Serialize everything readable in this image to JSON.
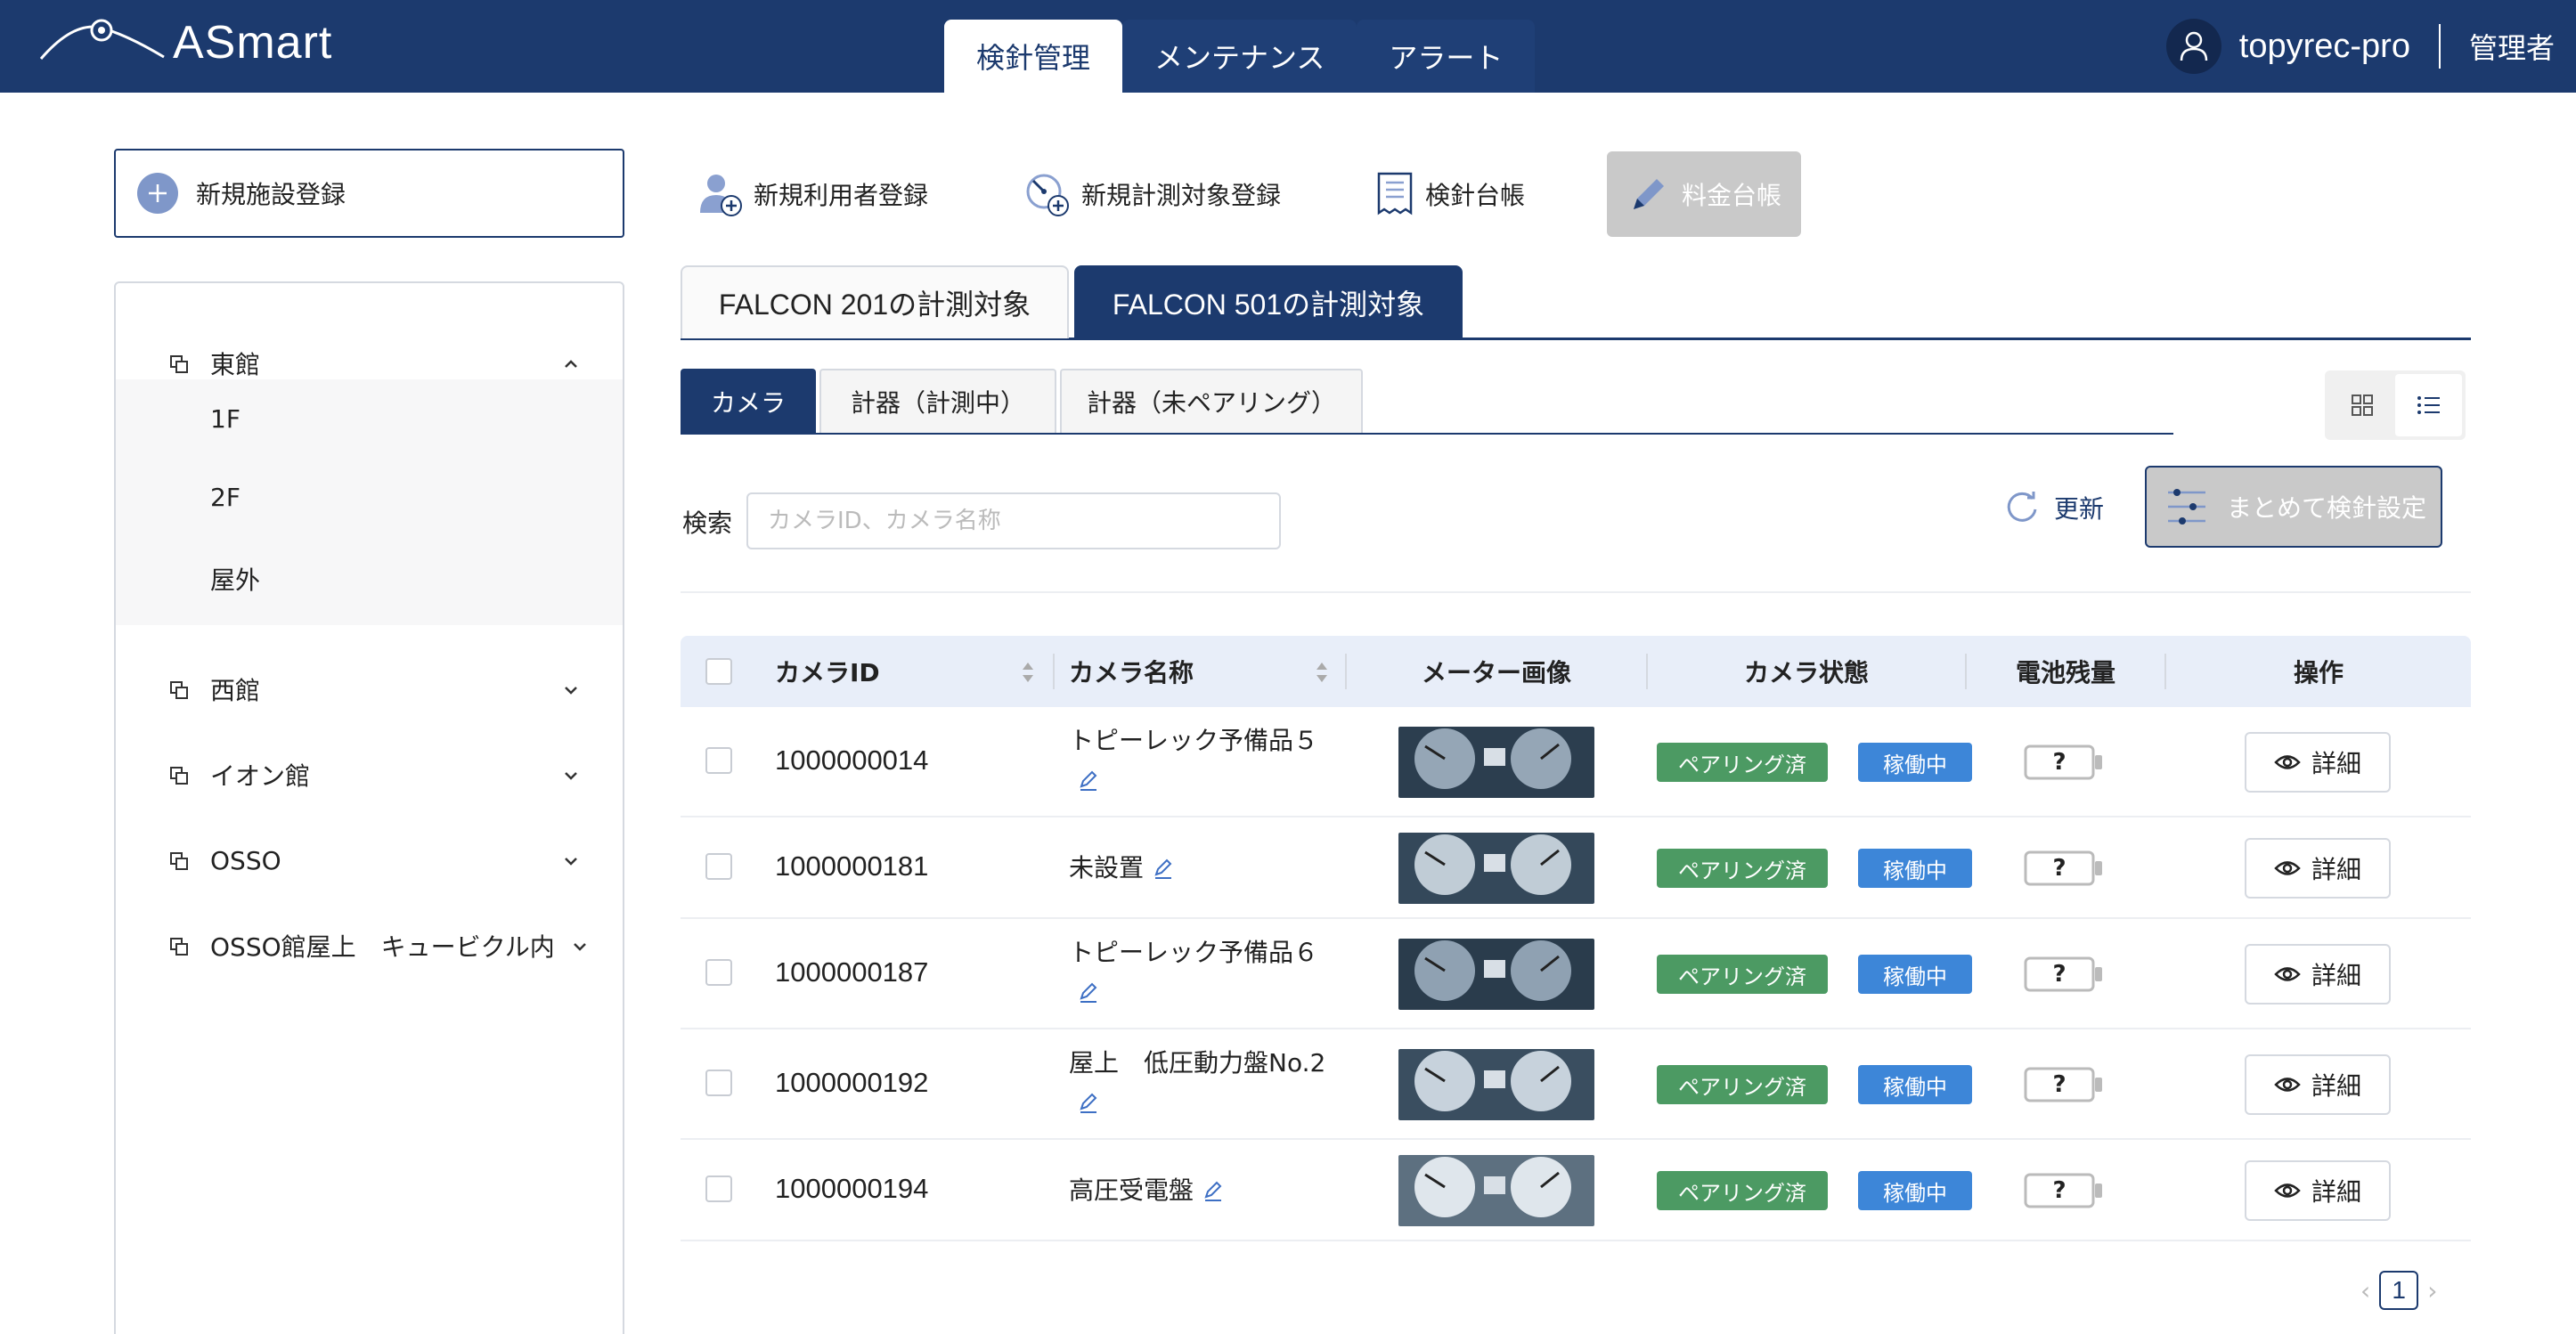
{
  "app": {
    "logo_text": "ASmart"
  },
  "nav": {
    "tabs": [
      "検針管理",
      "メンテナンス",
      "アラート"
    ],
    "active": 0
  },
  "user": {
    "name": "topyrec-pro",
    "role": "管理者"
  },
  "sidebar": {
    "new_facility_label": "新規施設登録",
    "tree": [
      {
        "label": "東館",
        "expanded": true,
        "children": [
          "1F",
          "2F",
          "屋外"
        ]
      },
      {
        "label": "西館",
        "expanded": false
      },
      {
        "label": "イオン館",
        "expanded": false
      },
      {
        "label": "OSSO",
        "expanded": false
      },
      {
        "label": "OSSO館屋上　キュービクル内",
        "expanded": false
      }
    ]
  },
  "toolbar": {
    "new_user": "新規利用者登録",
    "new_target": "新規計測対象登録",
    "ledger": "検針台帳",
    "fee_ledger": "料金台帳"
  },
  "main_tabs": [
    "FALCON 201の計測対象",
    "FALCON 501の計測対象"
  ],
  "sub_tabs": [
    "カメラ",
    "計器（計測中）",
    "計器（未ペアリング）"
  ],
  "search": {
    "label": "検索",
    "placeholder": "カメラID、カメラ名称",
    "value": ""
  },
  "actions": {
    "refresh": "更新",
    "bulk_setting": "まとめて検針設定"
  },
  "table": {
    "headers": [
      "カメラID",
      "カメラ名称",
      "メーター画像",
      "カメラ状態",
      "電池残量",
      "操作"
    ],
    "rows": [
      {
        "id": "1000000014",
        "name": "トピーレック予備品５",
        "pairing": "ペアリング済",
        "status": "稼働中",
        "battery": "?",
        "action": "詳細"
      },
      {
        "id": "1000000181",
        "name": "未設置",
        "pairing": "ペアリング済",
        "status": "稼働中",
        "battery": "?",
        "action": "詳細"
      },
      {
        "id": "1000000187",
        "name": "トピーレック予備品６",
        "pairing": "ペアリング済",
        "status": "稼働中",
        "battery": "?",
        "action": "詳細"
      },
      {
        "id": "1000000192",
        "name": "屋上　低圧動力盤No.2",
        "pairing": "ペアリング済",
        "status": "稼働中",
        "battery": "?",
        "action": "詳細"
      },
      {
        "id": "1000000194",
        "name": "高圧受電盤",
        "pairing": "ペアリング済",
        "status": "稼働中",
        "battery": "?",
        "action": "詳細"
      }
    ]
  },
  "pagination": {
    "current": "1"
  },
  "colors": {
    "primary": "#1c3a6e",
    "header_bg": "#1c3a6e",
    "pairing_badge": "#4c9a63",
    "status_badge": "#3d86d8",
    "table_header": "#e8eef9"
  }
}
